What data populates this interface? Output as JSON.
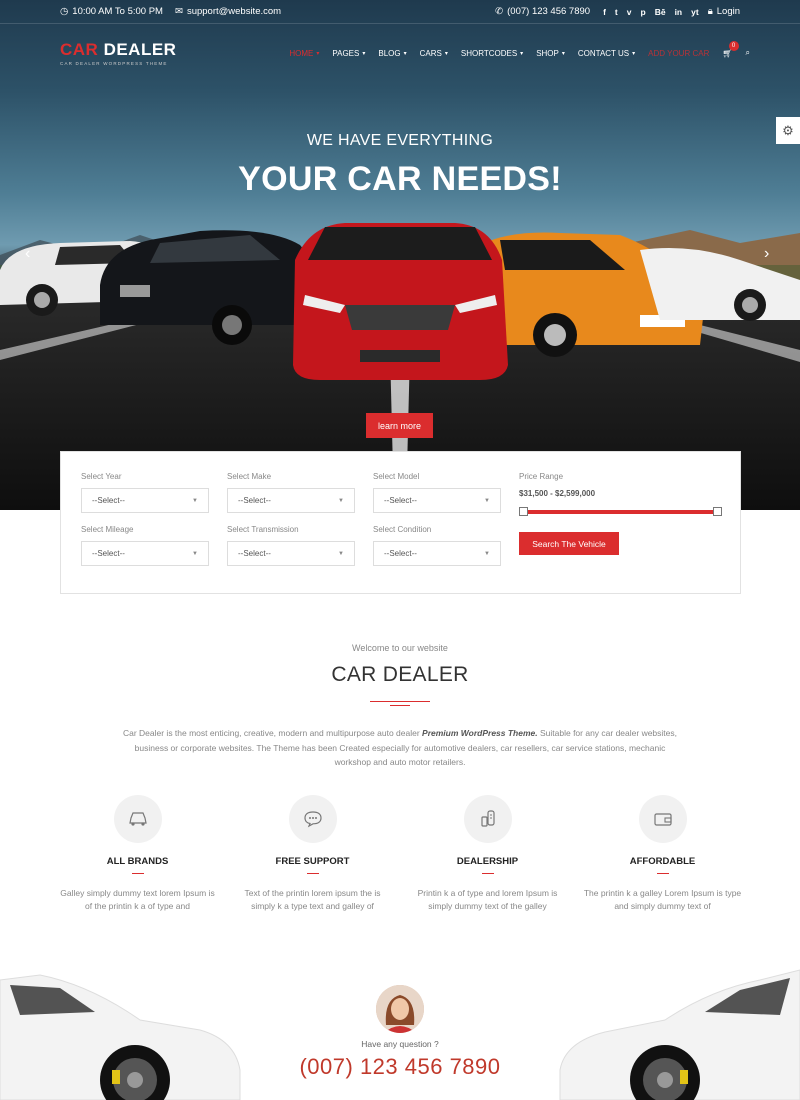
{
  "topbar": {
    "hours": "10:00 AM To 5:00 PM",
    "email": "support@website.com",
    "phone": "(007) 123 456 7890",
    "social": [
      "f",
      "t",
      "v",
      "p",
      "Bē",
      "in",
      "yt"
    ],
    "login": "Login"
  },
  "logo": {
    "part1": "CAR",
    "part2": " DEALER",
    "tagline": "CAR DEALER WORDPRESS THEME"
  },
  "nav": {
    "items": [
      {
        "label": "HOME"
      },
      {
        "label": "PAGES"
      },
      {
        "label": "BLOG"
      },
      {
        "label": "CARS"
      },
      {
        "label": "SHORTCODES"
      },
      {
        "label": "SHOP"
      },
      {
        "label": "CONTACT US"
      },
      {
        "label": "ADD YOUR CAR"
      }
    ],
    "cart_count": "0"
  },
  "hero": {
    "subtitle": "WE HAVE EVERYTHING",
    "title": "YOUR CAR NEEDS!",
    "button": "learn more"
  },
  "search": {
    "fields": [
      {
        "label": "Select Year",
        "value": "--Select--"
      },
      {
        "label": "Select Make",
        "value": "--Select--"
      },
      {
        "label": "Select Model",
        "value": "--Select--"
      },
      {
        "label": "Select Mileage",
        "value": "--Select--"
      },
      {
        "label": "Select Transmission",
        "value": "--Select--"
      },
      {
        "label": "Select Condition",
        "value": "--Select--"
      }
    ],
    "price_label": "Price Range",
    "price_value": "$31,500 - $2,599,000",
    "price_range_fraction": [
      0.0,
      1.0
    ],
    "button": "Search The Vehicle"
  },
  "welcome": {
    "kicker": "Welcome to our website",
    "title": "CAR DEALER",
    "desc_before": "Car Dealer is the most enticing, creative, modern and multipurpose auto dealer ",
    "desc_bold": "Premium WordPress Theme.",
    "desc_after": " Suitable for any car dealer websites, business or corporate websites. The Theme has been Created especially for automotive dealers, car resellers, car service stations, mechanic workshop and auto motor retailers."
  },
  "features": [
    {
      "title": "ALL BRANDS",
      "text": "Galley simply dummy text lorem Ipsum is of the printin k a of type and",
      "icon": "car-icon"
    },
    {
      "title": "FREE SUPPORT",
      "text": "Text of the printin lorem ipsum the is simply k a type text and galley of",
      "icon": "chat-icon"
    },
    {
      "title": "DEALERSHIP",
      "text": "Printin k a of type and lorem Ipsum is simply dummy text of the galley",
      "icon": "key-icon"
    },
    {
      "title": "AFFORDABLE",
      "text": "The printin k a galley Lorem Ipsum is type and simply dummy text of",
      "icon": "wallet-icon"
    }
  ],
  "contact": {
    "question": "Have any question ?",
    "phone": "(007) 123 456 7890"
  },
  "colors": {
    "accent": "#db2d2e"
  }
}
